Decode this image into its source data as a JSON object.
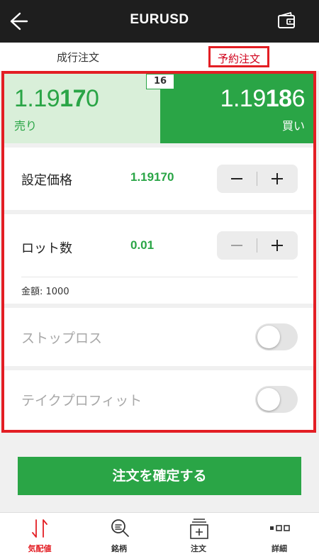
{
  "header": {
    "title": "EURUSD",
    "back_icon": "back-arrow-icon",
    "wallet_icon": "wallet-icon"
  },
  "tabs": [
    {
      "label": "成行注文",
      "active": false
    },
    {
      "label": "予約注文",
      "active": true
    }
  ],
  "quote": {
    "spread": "16",
    "sell": {
      "price_pre": "1.19",
      "price_big": "17",
      "price_post": "0",
      "label": "売り"
    },
    "buy": {
      "price_pre": "1.19",
      "price_big": "18",
      "price_post": "6",
      "label": "買い"
    }
  },
  "order": {
    "price": {
      "label": "設定価格",
      "value": "1.19170"
    },
    "lot": {
      "label": "ロット数",
      "value": "0.01",
      "amount": "金額: 1000"
    },
    "stop_loss": {
      "label": "ストップロス",
      "enabled": false
    },
    "take_profit": {
      "label": "テイクプロフィット",
      "enabled": false
    }
  },
  "confirm_label": "注文を確定する",
  "tabbar": [
    {
      "label": "気配値",
      "icon": "quotes-icon",
      "active": true
    },
    {
      "label": "銘柄",
      "icon": "search-symbols-icon",
      "active": false
    },
    {
      "label": "注文",
      "icon": "order-icon",
      "active": false
    },
    {
      "label": "詳細",
      "icon": "details-icon",
      "active": false
    }
  ],
  "colors": {
    "accent_green": "#2aa546",
    "sell_bg": "#d9efd9",
    "highlight_red": "#e31e24",
    "active_tab_red": "#d0021b",
    "header_bg": "#1e1e1e"
  }
}
